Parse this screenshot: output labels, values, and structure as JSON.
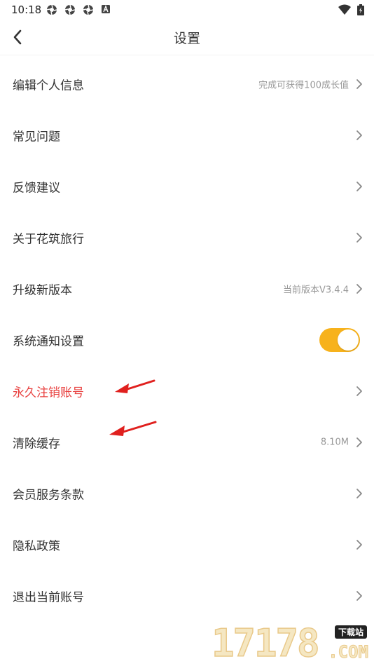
{
  "status_bar": {
    "time": "10:18",
    "left_icons": [
      "gear-icon",
      "gear-icon",
      "gear-icon",
      "a-badge-icon"
    ],
    "right_icons": [
      "wifi-icon",
      "battery-icon"
    ]
  },
  "nav": {
    "title": "设置",
    "back_icon": "chevron-left-icon"
  },
  "colors": {
    "accent": "#f7b21c",
    "danger": "#e8403f",
    "annotation_arrow": "#e0201e"
  },
  "settings": [
    {
      "label": "编辑个人信息",
      "value": "完成可获得100成长值"
    },
    {
      "label": "常见问题"
    },
    {
      "label": "反馈建议"
    },
    {
      "label": "关于花筑旅行"
    },
    {
      "label": "升级新版本",
      "value": "当前版本V3.4.4"
    },
    {
      "label": "系统通知设置",
      "toggle": true
    },
    {
      "label": "永久注销账号"
    },
    {
      "label": "清除缓存",
      "value": "8.10M"
    },
    {
      "label": "会员服务条款"
    },
    {
      "label": "隐私政策"
    },
    {
      "label": "退出当前账号"
    }
  ],
  "watermark": {
    "digits": "17178",
    "badge": "下载站",
    "domain": ".COM"
  }
}
